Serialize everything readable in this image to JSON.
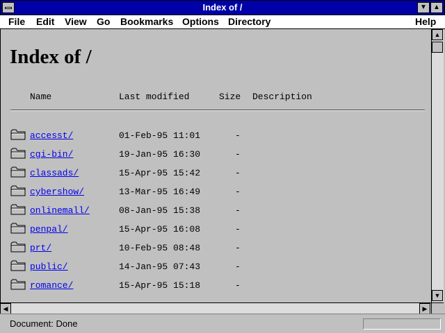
{
  "window": {
    "title": "Index of /"
  },
  "menubar": {
    "items": [
      "File",
      "Edit",
      "View",
      "Go",
      "Bookmarks",
      "Options",
      "Directory"
    ],
    "help": "Help"
  },
  "page": {
    "heading": "Index of /",
    "columns": {
      "name": "Name",
      "modified": "Last modified",
      "size": "Size",
      "description": "Description"
    },
    "entries": [
      {
        "name": "accesst/",
        "modified": "01-Feb-95 11:01",
        "size": "-"
      },
      {
        "name": "cgi-bin/",
        "modified": "19-Jan-95 16:30",
        "size": "-"
      },
      {
        "name": "classads/",
        "modified": "15-Apr-95 15:42",
        "size": "-"
      },
      {
        "name": "cybershow/",
        "modified": "13-Mar-95 16:49",
        "size": "-"
      },
      {
        "name": "onlinemall/",
        "modified": "08-Jan-95 15:38",
        "size": "-"
      },
      {
        "name": "penpal/",
        "modified": "15-Apr-95 16:08",
        "size": "-"
      },
      {
        "name": "prt/",
        "modified": "10-Feb-95 08:48",
        "size": "-"
      },
      {
        "name": "public/",
        "modified": "14-Jan-95 07:43",
        "size": "-"
      },
      {
        "name": "romance/",
        "modified": "15-Apr-95 15:18",
        "size": "-"
      }
    ]
  },
  "status": {
    "text": "Document: Done"
  },
  "icons": {
    "entry": "folder-icon"
  }
}
